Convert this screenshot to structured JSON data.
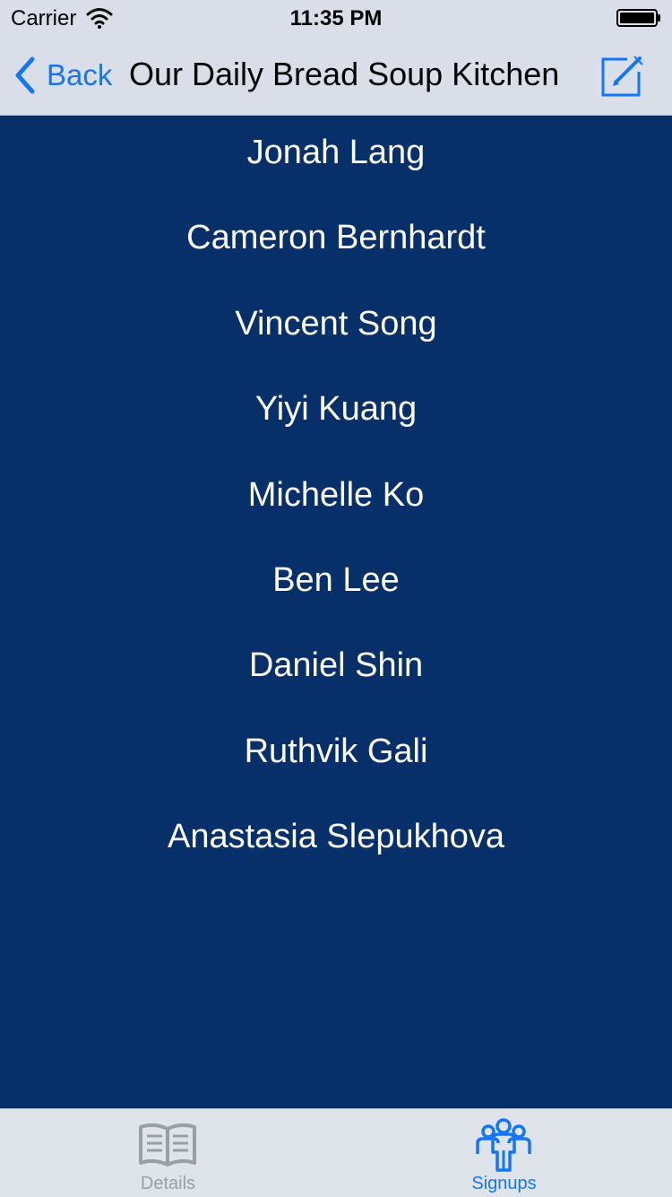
{
  "status_bar": {
    "carrier": "Carrier",
    "time": "11:35 PM"
  },
  "nav": {
    "back_label": "Back",
    "title": "Our Daily Bread Soup Kitchen",
    "compose_icon": "compose-icon"
  },
  "signups": [
    "Jonah Lang",
    "Cameron Bernhardt",
    "Vincent Song",
    "Yiyi Kuang",
    "Michelle Ko",
    "Ben Lee",
    "Daniel Shin",
    "Ruthvik Gali",
    "Anastasia Slepukhova"
  ],
  "tabs": [
    {
      "label": "Details",
      "icon": "book-icon",
      "selected": false
    },
    {
      "label": "Signups",
      "icon": "people-icon",
      "selected": true
    }
  ],
  "colors": {
    "accent": "#1476f5",
    "content_background": "#07306a",
    "bar_background": "#d9dee8",
    "inactive_tab": "#9a9ea6"
  }
}
